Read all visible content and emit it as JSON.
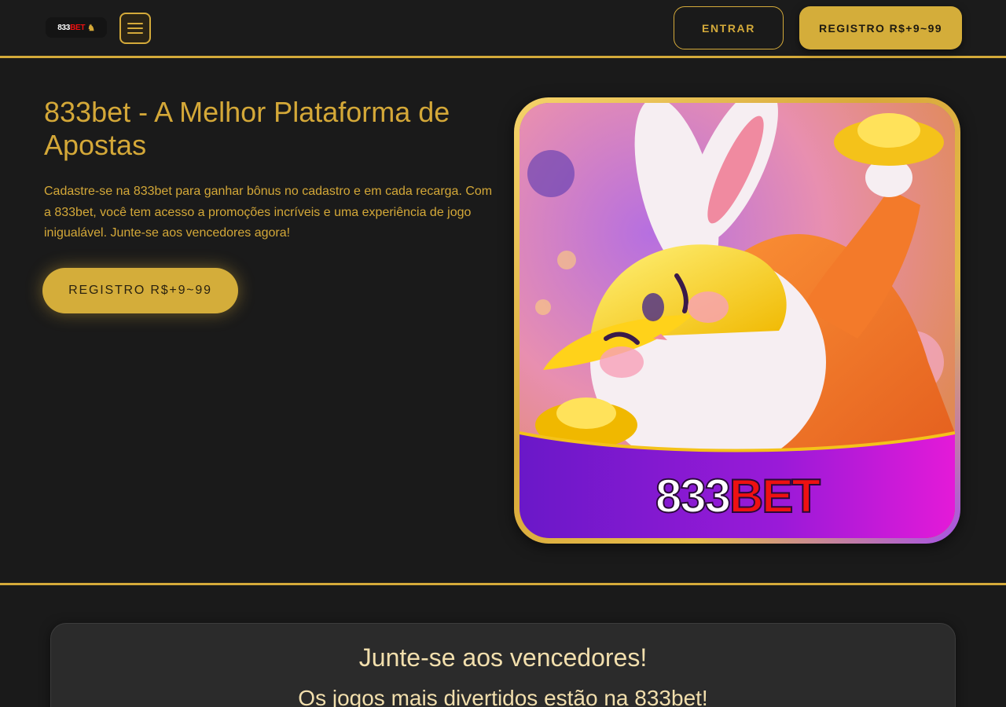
{
  "header": {
    "logo": {
      "num": "833",
      "brand": "BET",
      "icon": "horse-rider-icon"
    },
    "menu_icon": "hamburger-menu-icon",
    "entrar_label": "ENTRAR",
    "register_label": "REGISTRO R$+9~99"
  },
  "hero": {
    "title": "833bet - A Melhor Plataforma de Apostas",
    "description": "Cadastre-se na 833bet para ganhar bônus no cadastro e em cada recarga. Com a 833bet, você tem acesso a promoções incríveis e uma experiência de jogo inigualável. Junte-se aos vencedores agora!",
    "register_label": "REGISTRO R$+9~99",
    "image": {
      "label_num": "833",
      "label_brand": "BET",
      "subject": "rabbit-game-artwork"
    }
  },
  "join": {
    "title": "Junte-se aos vencedores!",
    "subtitle": "Os jogos mais divertidos estão na 833bet!"
  },
  "colors": {
    "background": "#1a1a1a",
    "accent_gold": "#d4aa3a",
    "panel": "#2b2b2b",
    "panel_text": "#f2dfad"
  }
}
